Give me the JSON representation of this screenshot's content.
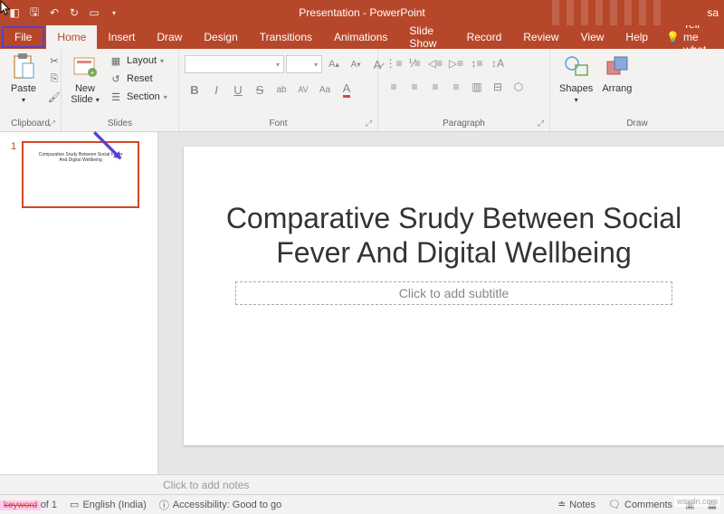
{
  "title_bar": {
    "doc_title": "Presentation - PowerPoint",
    "right_text": "sa"
  },
  "menu": {
    "items": [
      "File",
      "Home",
      "Insert",
      "Draw",
      "Design",
      "Transitions",
      "Animations",
      "Slide Show",
      "Record",
      "Review",
      "View",
      "Help"
    ],
    "active": "Home",
    "tell_me": "Tell me what"
  },
  "ribbon": {
    "clipboard": {
      "label": "Clipboard",
      "paste": "Paste"
    },
    "slides": {
      "label": "Slides",
      "new_slide": "New\nSlide",
      "layout": "Layout",
      "reset": "Reset",
      "section": "Section"
    },
    "font": {
      "label": "Font"
    },
    "paragraph": {
      "label": "Paragraph"
    },
    "drawing": {
      "label": "Draw",
      "shapes": "Shapes",
      "arrange": "Arrang"
    }
  },
  "slides_panel": {
    "slide_num": "1",
    "thumb_text": "Comparative Srudy Between Social Fever And Digital Wellbeing"
  },
  "slide": {
    "title": "Comparative Srudy Between Social Fever And Digital Wellbeing",
    "subtitle_placeholder": "Click to add subtitle"
  },
  "notes": {
    "placeholder": "Click to add notes"
  },
  "status": {
    "slide_info": "Slide 1 of 1",
    "language": "English (India)",
    "accessibility": "Accessibility: Good to go",
    "notes": "Notes",
    "comments": "Comments"
  },
  "watermark": "wsxdn.com",
  "keyword": "keyword"
}
